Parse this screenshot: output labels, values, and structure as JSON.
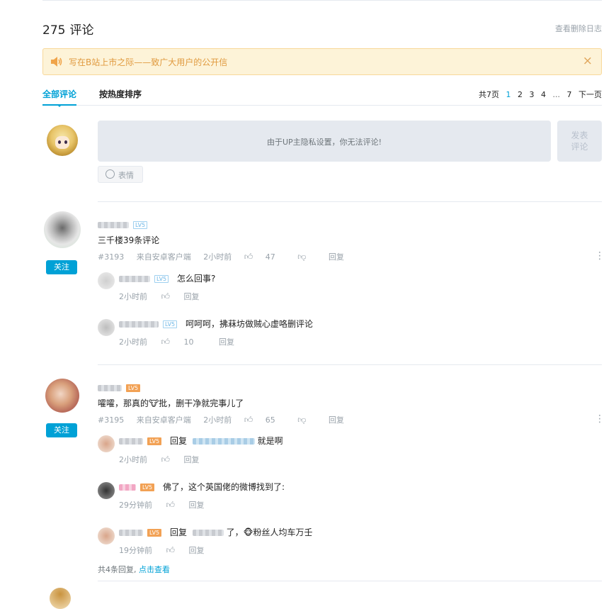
{
  "header": {
    "count": "275",
    "title": "评论",
    "delete_log": "查看删除日志"
  },
  "notice": {
    "text": "写在B站上市之际——致广大用户的公开信",
    "close": "×",
    "icon": "speaker-icon"
  },
  "tabs": {
    "all": "全部评论",
    "hot": "按热度排序"
  },
  "pager": {
    "total": "共7页",
    "pages": [
      "1",
      "2",
      "3",
      "4"
    ],
    "dots": "...",
    "last": "7",
    "next": "下一页"
  },
  "composer": {
    "hint": "由于UP主隐私设置，你无法评论!",
    "submit_line1": "发表",
    "submit_line2": "评论",
    "emoji": "表情"
  },
  "comments": [
    {
      "level": "LV5",
      "content": "三千楼39条评论",
      "floor": "#3193",
      "client": "来自安卓客户端",
      "time": "2小时前",
      "likes": "47",
      "reply": "回复",
      "follow": "关注",
      "replies": [
        {
          "level": "LV5",
          "text": "怎么回事?",
          "time": "2小时前",
          "likes": "",
          "reply": "回复"
        },
        {
          "level": "LV5",
          "text": "呵呵呵，拂菻坊做贼心虚咯删评论",
          "time": "2小时前",
          "likes": "10",
          "reply": "回复"
        }
      ]
    },
    {
      "level": "LV5",
      "content": "嚯嚯，那真的🐮批，删干净就完事儿了",
      "floor": "#3195",
      "client": "来自安卓客户端",
      "time": "2小时前",
      "likes": "65",
      "reply": "回复",
      "follow": "关注",
      "replies": [
        {
          "level": "LV5",
          "prefix": "回复",
          "text": "就是啊",
          "time": "2小时前",
          "likes": "",
          "reply": "回复"
        },
        {
          "level": "LV5",
          "text": "佛了，这个英国佬的微博找到了:",
          "time": "29分钟前",
          "likes": "",
          "reply": "回复"
        },
        {
          "level": "LV5",
          "prefix": "回复",
          "text": "了，🐵粉丝人均车万壬",
          "time": "19分钟前",
          "likes": "",
          "reply": "回复"
        }
      ],
      "view_all": {
        "text": "共4条回复,",
        "link": "点击查看"
      }
    }
  ],
  "colors": {
    "accent": "#00a1d6",
    "notice_bg": "#fdf3d8",
    "notice_text": "#e09a3f",
    "level_orange": "#f2a154"
  }
}
